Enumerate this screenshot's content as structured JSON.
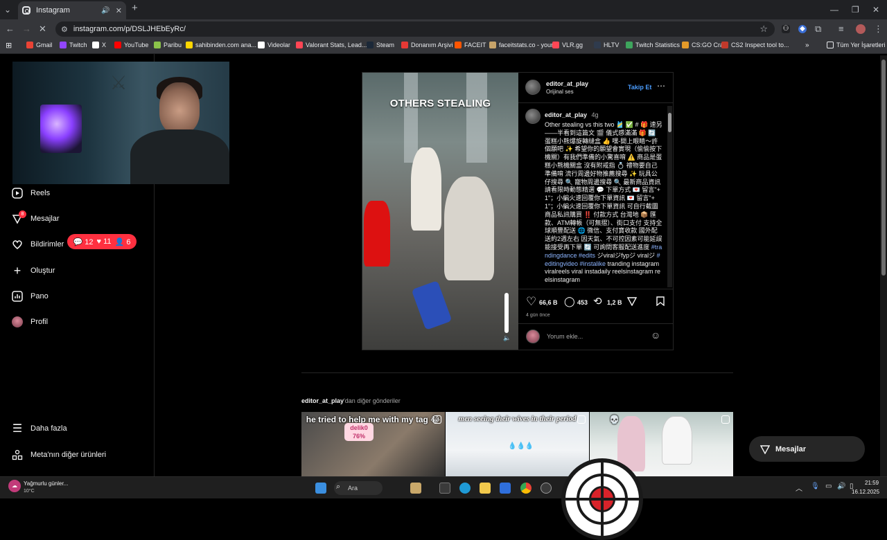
{
  "browser": {
    "tab_title": "Instagram",
    "url": "instagram.com/p/DSLJHEbEyRc/",
    "bookmarks": [
      "Gmail",
      "Twitch",
      "X",
      "YouTube",
      "Paribu",
      "sahibinden.com ana...",
      "Videolar",
      "Valorant Stats, Lead...",
      "Steam",
      "Donanım Arşivi",
      "FACEIT",
      "faceitstats.co - your...",
      "VLR.gg",
      "HLTV",
      "Twitch Statistics",
      "CS:GO Craft",
      "CS2 Inspect tool to..."
    ],
    "all_bookmarks_label": "Tüm Yer İşaretleri",
    "bookmark_colors": [
      "#ea4335",
      "#9146ff",
      "#ffffff",
      "#ff0000",
      "#8bc34a",
      "#ffd600",
      "#ffffff",
      "#ff4655",
      "#1b2838",
      "#e53935",
      "#ff5500",
      "#c8a46a",
      "#ff4655",
      "#2f3b4d",
      "#3ea55d",
      "#e39a29",
      "#c0392b"
    ]
  },
  "sidebar": {
    "items": [
      {
        "label": "Reels",
        "icon": "reels-icon"
      },
      {
        "label": "Mesajlar",
        "icon": "messenger-icon",
        "badge": "8"
      },
      {
        "label": "Bildirimler",
        "icon": "heart-icon"
      },
      {
        "label": "Oluştur",
        "icon": "plus-icon"
      },
      {
        "label": "Pano",
        "icon": "dashboard-icon"
      },
      {
        "label": "Profil",
        "icon": "avatar-icon"
      }
    ],
    "more_label": "Daha fazla",
    "meta_label": "Meta'nın diğer ürünleri",
    "notif_pill": {
      "comments": "12",
      "likes": "11",
      "follows": "6"
    }
  },
  "post": {
    "video_caption": "OTHERS STEALING",
    "username": "editor_at_play",
    "audio": "Orijinal ses",
    "follow_label": "Takip Et",
    "caption_username": "editor_at_play",
    "caption_age": "4g",
    "caption_pre": "Other stealing vs this two 🎽 ✅ # 🎁 速另——半看到這篇文 🎬 儀式感滿滿 🎁 🔄 蛋糕小熊爆旋轉縫盒 👍 嘿-開上眼睛～許個願吧 ✨ 希望你的願望會實現（偷偷按下機關）有我們準備的小驚喜唷 ⚠️ 商品是蛋糕小熊機關盒 沒有附戒指 💍 禮物要自己準備唷 流行周邊好物推薦搜尋 ✨ 玩具公仔搜尋 🔍 寵物周邊搜尋 🔍 最新商品資訊請看限時動態精選 💬 下單方式 💌 留言\"+1\"；小編火速回覆你下單資訊 💌 留言\"+1\"；小編火速回覆你下單資訊 可自行截圖商品私訊購買 ‼️ 付款方式 台灣地 📦 匯款、ATM轉帳（可無摺）、街口支付 支持全球順豐配送 🌐 微信、支付寶收款 國外配送約2週左右 因天氣、不可控因素可能延誤 能接受再下單 🔄 可詢問客服配送進度 ",
    "caption_tags": "#trandingdance #edits",
    "caption_mid": " ジviralジfypジ viralジ ",
    "caption_tags2": "#editingvideo #instalike",
    "caption_post": " tranding instagram viralreels viral instadaily reelsinstagram reelsinstagram",
    "likes": "66,6 B",
    "comments": "453",
    "reposts": "1,2 B",
    "time_ago": "4 gün önce",
    "comment_placeholder": "Yorum ekle..."
  },
  "more_posts": {
    "author": "editor_at_play",
    "label_suffix": "'dan diğer gönderiler",
    "thumbs": [
      {
        "caption": "he tried to help me with my tag 😂",
        "sticker": "delik0 76%"
      },
      {
        "caption": "men seeing their wives in their period",
        "sticker": ""
      },
      {
        "caption": "💀",
        "sticker": ""
      }
    ]
  },
  "floating_messages_label": "Mesajlar",
  "taskbar": {
    "weather_title": "Yağmurlu günler...",
    "weather_temp": "10°C",
    "time": "21:59",
    "date": "16.12.2025",
    "search_placeholder": "Ara"
  }
}
